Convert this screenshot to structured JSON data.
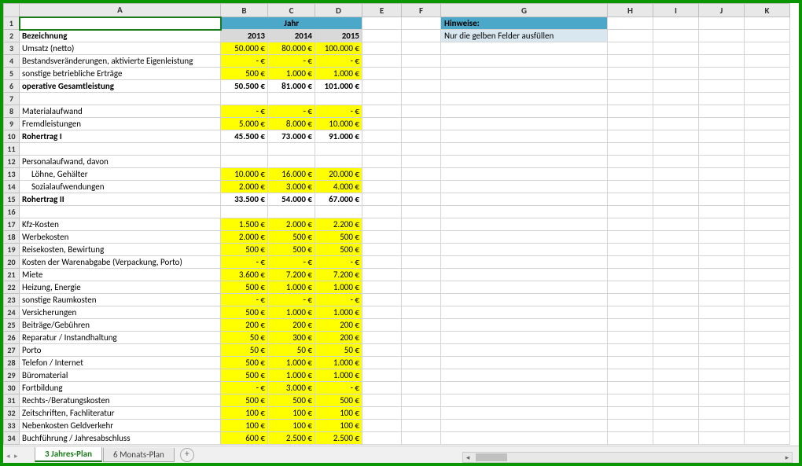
{
  "columns": [
    "A",
    "B",
    "C",
    "D",
    "E",
    "F",
    "G",
    "H",
    "I",
    "J",
    "K"
  ],
  "jahr_header": "Jahr",
  "years": [
    "2013",
    "2014",
    "2015"
  ],
  "hint_header": "Hinweise:",
  "hint_body": "Nur die gelben Felder ausfüllen",
  "bezeichnung": "Bezeichnung",
  "rows": [
    {
      "n": 3,
      "label": "Umsatz (netto)",
      "vals": [
        "50.000 €",
        "80.000 €",
        "100.000 €"
      ],
      "style": "yellow"
    },
    {
      "n": 4,
      "label": "Bestandsveränderungen, aktivierte Eigenleistung",
      "vals": [
        "-   €",
        "-   €",
        "-   €"
      ],
      "style": "yellow"
    },
    {
      "n": 5,
      "label": "sonstige betriebliche Erträge",
      "vals": [
        "500 €",
        "1.000 €",
        "1.000 €"
      ],
      "style": "yellow"
    },
    {
      "n": 6,
      "label": "operative Gesamtleistung",
      "vals": [
        "50.500 €",
        "81.000 €",
        "101.000 €"
      ],
      "style": "bold",
      "labelBold": true
    },
    {
      "n": 7,
      "label": "",
      "vals": [
        "",
        "",
        ""
      ],
      "style": ""
    },
    {
      "n": 8,
      "label": "Materialaufwand",
      "vals": [
        "-   €",
        "-   €",
        "-   €"
      ],
      "style": "yellow"
    },
    {
      "n": 9,
      "label": "Fremdleistungen",
      "vals": [
        "5.000 €",
        "8.000 €",
        "10.000 €"
      ],
      "style": "yellow"
    },
    {
      "n": 10,
      "label": "Rohertrag I",
      "vals": [
        "45.500 €",
        "73.000 €",
        "91.000 €"
      ],
      "style": "bold",
      "labelBold": true
    },
    {
      "n": 11,
      "label": "",
      "vals": [
        "",
        "",
        ""
      ],
      "style": ""
    },
    {
      "n": 12,
      "label": "Personalaufwand, davon",
      "vals": [
        "",
        "",
        ""
      ],
      "style": ""
    },
    {
      "n": 13,
      "label": "Löhne, Gehälter",
      "vals": [
        "10.000 €",
        "16.000 €",
        "20.000 €"
      ],
      "style": "yellow",
      "indent": true
    },
    {
      "n": 14,
      "label": "Sozialaufwendungen",
      "vals": [
        "2.000 €",
        "3.000 €",
        "4.000 €"
      ],
      "style": "yellow",
      "indent": true
    },
    {
      "n": 15,
      "label": "Rohertrag II",
      "vals": [
        "33.500 €",
        "54.000 €",
        "67.000 €"
      ],
      "style": "bold",
      "labelBold": true
    },
    {
      "n": 16,
      "label": "",
      "vals": [
        "",
        "",
        ""
      ],
      "style": ""
    },
    {
      "n": 17,
      "label": "Kfz-Kosten",
      "vals": [
        "1.500 €",
        "2.000 €",
        "2.200 €"
      ],
      "style": "yellow"
    },
    {
      "n": 18,
      "label": "Werbekosten",
      "vals": [
        "2.000 €",
        "500 €",
        "500 €"
      ],
      "style": "yellow"
    },
    {
      "n": 19,
      "label": "Reisekosten, Bewirtung",
      "vals": [
        "500 €",
        "500 €",
        "500 €"
      ],
      "style": "yellow"
    },
    {
      "n": 20,
      "label": "Kosten der Warenabgabe (Verpackung, Porto)",
      "vals": [
        "-   €",
        "-   €",
        "-   €"
      ],
      "style": "yellow"
    },
    {
      "n": 21,
      "label": "Miete",
      "vals": [
        "3.600 €",
        "7.200 €",
        "7.200 €"
      ],
      "style": "yellow"
    },
    {
      "n": 22,
      "label": "Heizung, Energie",
      "vals": [
        "500 €",
        "1.000 €",
        "1.000 €"
      ],
      "style": "yellow"
    },
    {
      "n": 23,
      "label": "sonstige Raumkosten",
      "vals": [
        "-   €",
        "-   €",
        "-   €"
      ],
      "style": "yellow"
    },
    {
      "n": 24,
      "label": "Versicherungen",
      "vals": [
        "500 €",
        "1.000 €",
        "1.000 €"
      ],
      "style": "yellow"
    },
    {
      "n": 25,
      "label": "Beiträge/Gebühren",
      "vals": [
        "200 €",
        "200 €",
        "200 €"
      ],
      "style": "yellow"
    },
    {
      "n": 26,
      "label": "Reparatur / Instandhaltung",
      "vals": [
        "50 €",
        "300 €",
        "200 €"
      ],
      "style": "yellow"
    },
    {
      "n": 27,
      "label": "Porto",
      "vals": [
        "50 €",
        "50 €",
        "50 €"
      ],
      "style": "yellow"
    },
    {
      "n": 28,
      "label": "Telefon / Internet",
      "vals": [
        "500 €",
        "1.000 €",
        "1.000 €"
      ],
      "style": "yellow"
    },
    {
      "n": 29,
      "label": "Büromaterial",
      "vals": [
        "500 €",
        "1.000 €",
        "1.000 €"
      ],
      "style": "yellow"
    },
    {
      "n": 30,
      "label": "Fortbildung",
      "vals": [
        "-   €",
        "3.000 €",
        "-   €"
      ],
      "style": "yellow"
    },
    {
      "n": 31,
      "label": "Rechts-/Beratungskosten",
      "vals": [
        "500 €",
        "500 €",
        "500 €"
      ],
      "style": "yellow"
    },
    {
      "n": 32,
      "label": "Zeitschriften, Fachliteratur",
      "vals": [
        "100 €",
        "100 €",
        "100 €"
      ],
      "style": "yellow"
    },
    {
      "n": 33,
      "label": "Nebenkosten Geldverkehr",
      "vals": [
        "100 €",
        "100 €",
        "100 €"
      ],
      "style": "yellow"
    },
    {
      "n": 34,
      "label": "Buchführung / Jahresabschluss",
      "vals": [
        "600 €",
        "2.500 €",
        "2.500 €"
      ],
      "style": "yellow"
    }
  ],
  "tabs": {
    "active": "3 Jahres-Plan",
    "other": "6 Monats-Plan"
  }
}
